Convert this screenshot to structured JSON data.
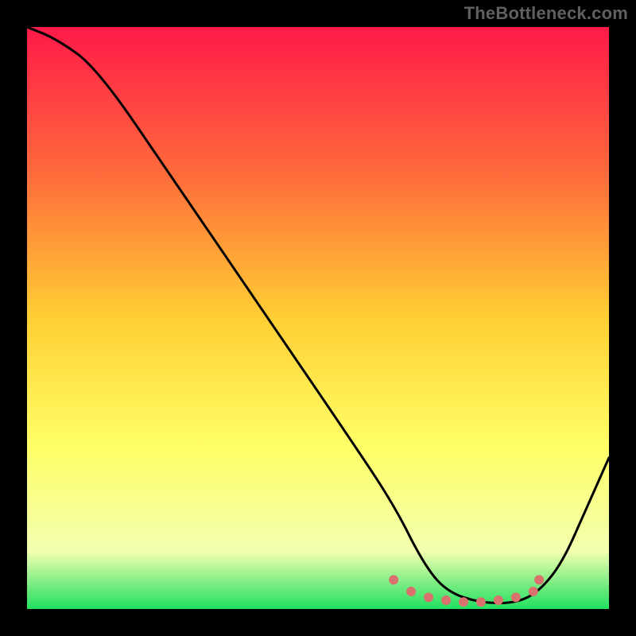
{
  "watermark": "TheBottleneck.com",
  "chart_data": {
    "type": "line",
    "title": "",
    "xlabel": "",
    "ylabel": "",
    "xlim": [
      0,
      100
    ],
    "ylim": [
      0,
      100
    ],
    "gradient_stops": [
      {
        "offset": 0,
        "color": "#ff1a49"
      },
      {
        "offset": 25,
        "color": "#ff6a3c"
      },
      {
        "offset": 50,
        "color": "#ffcf33"
      },
      {
        "offset": 72,
        "color": "#ffff66"
      },
      {
        "offset": 90,
        "color": "#f3ffb0"
      },
      {
        "offset": 100,
        "color": "#20e060"
      }
    ],
    "series": [
      {
        "name": "bottleneck-curve",
        "x": [
          0,
          5,
          12,
          25,
          40,
          55,
          63,
          68,
          72,
          78,
          84,
          88,
          92,
          96,
          100
        ],
        "values": [
          100,
          98,
          93,
          74,
          52,
          30,
          18,
          8,
          3,
          1,
          1,
          3,
          8,
          17,
          26
        ]
      }
    ],
    "markers": {
      "name": "highlight-region",
      "color": "#d9716e",
      "x": [
        63,
        66,
        69,
        72,
        75,
        78,
        81,
        84,
        87,
        88
      ],
      "values": [
        5,
        3,
        2,
        1.5,
        1.2,
        1.2,
        1.5,
        2,
        3,
        5
      ]
    }
  }
}
